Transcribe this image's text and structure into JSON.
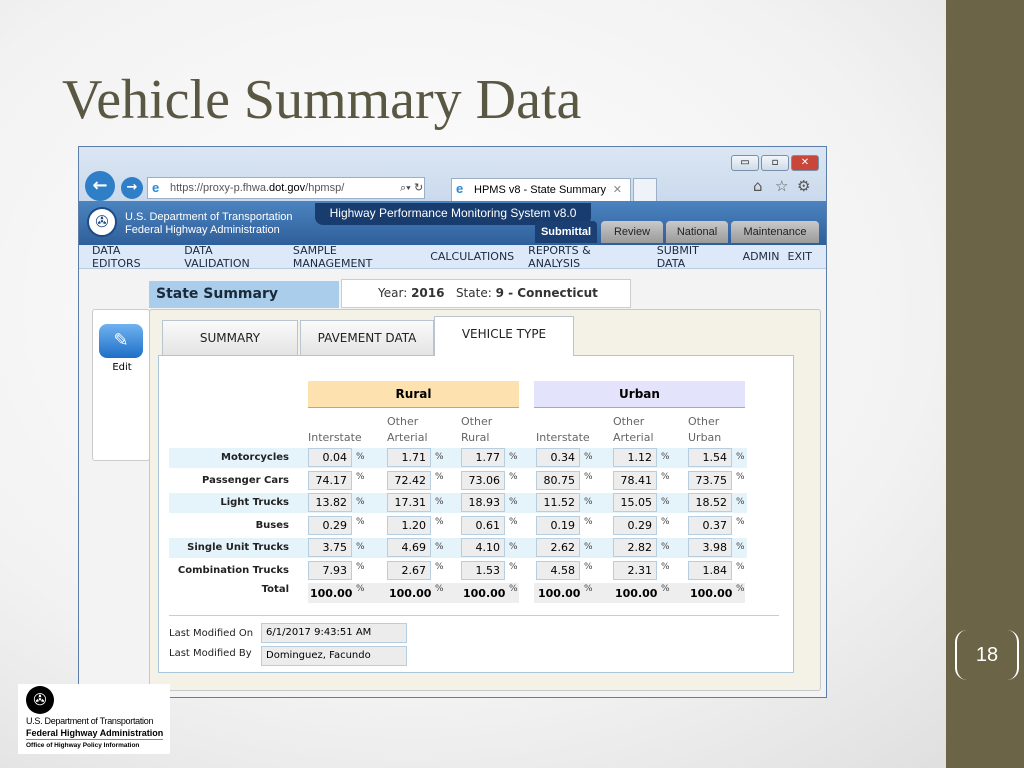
{
  "slide": {
    "title": "Vehicle Summary Data",
    "page_number": "18"
  },
  "browser": {
    "url_prefix": "https://proxy-p.fhwa.",
    "url_domain": "dot.gov",
    "url_suffix": "/hpmsp/",
    "tab_title": "HPMS v8 - State Summary",
    "icons": [
      "back-icon",
      "forward-icon",
      "search-icon",
      "refresh-icon",
      "close-tab-icon",
      "home-icon",
      "favorites-star-icon",
      "gear-icon",
      "minimize-icon",
      "maximize-icon",
      "close-window-icon"
    ]
  },
  "app": {
    "org_line1": "U.S. Department of Transportation",
    "org_line2": "Federal Highway Administration",
    "system_title": "Highway Performance Monitoring System v8.0",
    "nav_tabs": [
      "Submittal",
      "Review",
      "National",
      "Maintenance"
    ],
    "menu": [
      "DATA EDITORS",
      "DATA VALIDATION",
      "SAMPLE MANAGEMENT",
      "CALCULATIONS",
      "REPORTS & ANALYSIS",
      "SUBMIT DATA",
      "ADMIN",
      "EXIT"
    ],
    "accent": "#2f5f9a"
  },
  "summary": {
    "heading": "State Summary",
    "year_label": "Year:",
    "year": "2016",
    "state_label": "State:",
    "state": "9 - Connecticut",
    "edit_label": "Edit",
    "tabs": [
      "SUMMARY",
      "PAVEMENT DATA",
      "VEHICLE TYPE"
    ],
    "active_tab": "VEHICLE TYPE"
  },
  "table": {
    "rural": "Rural",
    "urban": "Urban",
    "rural_color": "#fde2b0",
    "urban_color": "#e3e4fb",
    "columns": [
      [
        "",
        "Interstate"
      ],
      [
        "Other",
        "Arterial"
      ],
      [
        "Other",
        "Rural"
      ],
      [
        "",
        "Interstate"
      ],
      [
        "Other",
        "Arterial"
      ],
      [
        "Other",
        "Urban"
      ]
    ],
    "unit": "%",
    "rows": [
      {
        "label": "Motorcycles",
        "values": [
          "0.04",
          "1.71",
          "1.77",
          "0.34",
          "1.12",
          "1.54"
        ]
      },
      {
        "label": "Passenger Cars",
        "values": [
          "74.17",
          "72.42",
          "73.06",
          "80.75",
          "78.41",
          "73.75"
        ]
      },
      {
        "label": "Light Trucks",
        "values": [
          "13.82",
          "17.31",
          "18.93",
          "11.52",
          "15.05",
          "18.52"
        ]
      },
      {
        "label": "Buses",
        "values": [
          "0.29",
          "1.20",
          "0.61",
          "0.19",
          "0.29",
          "0.37"
        ]
      },
      {
        "label": "Single Unit Trucks",
        "values": [
          "3.75",
          "4.69",
          "4.10",
          "2.62",
          "2.82",
          "3.98"
        ]
      },
      {
        "label": "Combination Trucks",
        "values": [
          "7.93",
          "2.67",
          "1.53",
          "4.58",
          "2.31",
          "1.84"
        ]
      }
    ],
    "total": {
      "label": "Total",
      "values": [
        "100.00",
        "100.00",
        "100.00",
        "100.00",
        "100.00",
        "100.00"
      ]
    }
  },
  "meta": {
    "modified_on_label": "Last Modified On",
    "modified_on": "6/1/2017 9:43:51 AM",
    "modified_by_label": "Last Modified By",
    "modified_by": "Dominguez, Facundo"
  },
  "footer_logo": {
    "line1": "U.S. Department of Transportation",
    "line2": "Federal Highway Administration",
    "line3": "Office of Highway Policy Information"
  }
}
